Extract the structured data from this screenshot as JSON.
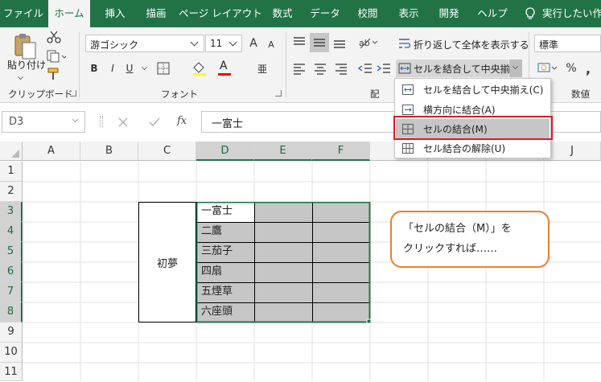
{
  "tabs": [
    "ファイル",
    "ホーム",
    "挿入",
    "描画",
    "ページ レイアウト",
    "数式",
    "データ",
    "校閲",
    "表示",
    "開発",
    "ヘルプ",
    "実行したい作"
  ],
  "tell_me_icon": "lightbulb-icon",
  "ribbon": {
    "clipboard": {
      "paste_label": "貼り付け",
      "group_label": "クリップボード"
    },
    "font": {
      "font_name": "游ゴシック",
      "font_size": "11",
      "bold": "B",
      "italic": "I",
      "underline": "U",
      "grow": "A",
      "shrink": "A",
      "font_color_label": "A",
      "phonetic_label": "亜",
      "group_label": "フォント"
    },
    "alignment": {
      "wrap_label": "折り返して全体を表示する",
      "merge_label": "セルを結合して中央揃え",
      "group_label_partial": "配"
    },
    "number": {
      "format": "標準",
      "percent": "%",
      "comma": ",",
      "group_label": "数値"
    }
  },
  "merge_menu": {
    "items": [
      {
        "label": "セルを結合して中央揃え(C)",
        "highlighted": false
      },
      {
        "label": "横方向に結合(A)",
        "highlighted": false
      },
      {
        "label": "セルの結合(M)",
        "highlighted": true
      },
      {
        "label": "セル結合の解除(U)",
        "highlighted": false
      }
    ]
  },
  "formula_bar": {
    "name_box": "D3",
    "fx": "fx",
    "content": "一富士"
  },
  "columns": [
    "A",
    "B",
    "C",
    "D",
    "E",
    "F",
    "G",
    "H",
    "I",
    "J"
  ],
  "rows": [
    "1",
    "2",
    "3",
    "4",
    "5",
    "6",
    "7",
    "8",
    "9",
    "10",
    "11"
  ],
  "sheet": {
    "merged_c": "初夢",
    "d_values": [
      "一富士",
      "二鷹",
      "三茄子",
      "四扇",
      "五煙草",
      "六座頭"
    ]
  },
  "callout": {
    "line1": "「セルの結合（M）」を",
    "line2": "クリックすれば……"
  },
  "colors": {
    "excel_green": "#217346",
    "selection_fill": "#c6c6c6",
    "callout_border": "#ed7d31",
    "highlight_border": "#e01b24"
  }
}
